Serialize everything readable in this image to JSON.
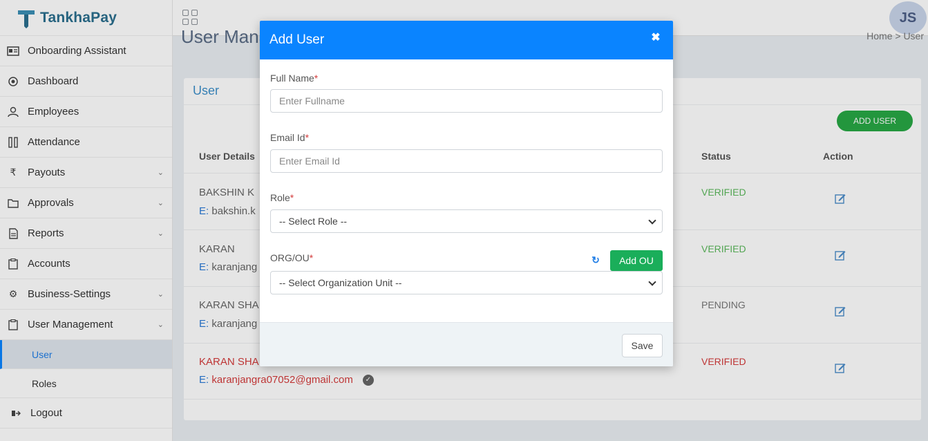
{
  "brand": {
    "name_part1": "Tankha",
    "name_part2": "Pay"
  },
  "header": {
    "avatar_initials": "JS"
  },
  "page": {
    "title": "User Mana",
    "breadcrumb": "Home > User"
  },
  "sidebar": {
    "items": [
      {
        "label": "Onboarding Assistant",
        "icon": "id-card-icon"
      },
      {
        "label": "Dashboard",
        "icon": "target-icon"
      },
      {
        "label": "Employees",
        "icon": "user-icon"
      },
      {
        "label": "Attendance",
        "icon": "attendance-icon"
      },
      {
        "label": "Payouts",
        "icon": "rupee-icon"
      },
      {
        "label": "Approvals",
        "icon": "folder-icon"
      },
      {
        "label": "Reports",
        "icon": "document-icon"
      },
      {
        "label": "Accounts",
        "icon": "clipboard-icon"
      },
      {
        "label": "Business-Settings",
        "icon": "gear-icon"
      },
      {
        "label": "User Management",
        "icon": "clipboard-icon"
      }
    ],
    "sub_items": [
      {
        "label": "User"
      },
      {
        "label": "Roles"
      }
    ],
    "logout": "Logout"
  },
  "card": {
    "title": "User",
    "add_user_label": "ADD USER",
    "columns": {
      "details": "User Details",
      "status": "Status",
      "action": "Action"
    },
    "rows": [
      {
        "name": "BAKSHIN K",
        "email_prefix": "E:",
        "email": "bakshin.k",
        "status": "VERIFIED"
      },
      {
        "name": "KARAN",
        "email_prefix": "E:",
        "email": "karanjang",
        "status": "VERIFIED"
      },
      {
        "name": "KARAN SHA",
        "email_prefix": "E:",
        "email": "karanjang",
        "status": "PENDING"
      },
      {
        "name": "KARAN SHA",
        "email_prefix": "E:",
        "email": "karanjangra07052@gmail.com",
        "status": "VERIFIED"
      }
    ]
  },
  "colors": {
    "primary": "#0a84ff",
    "success": "#1aae5a",
    "verified": "#5cb85c",
    "danger": "#d43c3c"
  },
  "modal": {
    "title": "Add User",
    "close_icon": "close-icon",
    "full_name_label": "Full Name",
    "full_name_placeholder": "Enter Fullname",
    "email_label": "Email Id",
    "email_placeholder": "Enter Email Id",
    "role_label": "Role",
    "role_selected": "-- Select Role --",
    "org_label": "ORG/OU",
    "org_selected": "-- Select Organization Unit --",
    "add_ou_label": "Add OU",
    "required_mark": "*",
    "save_label": "Save"
  }
}
